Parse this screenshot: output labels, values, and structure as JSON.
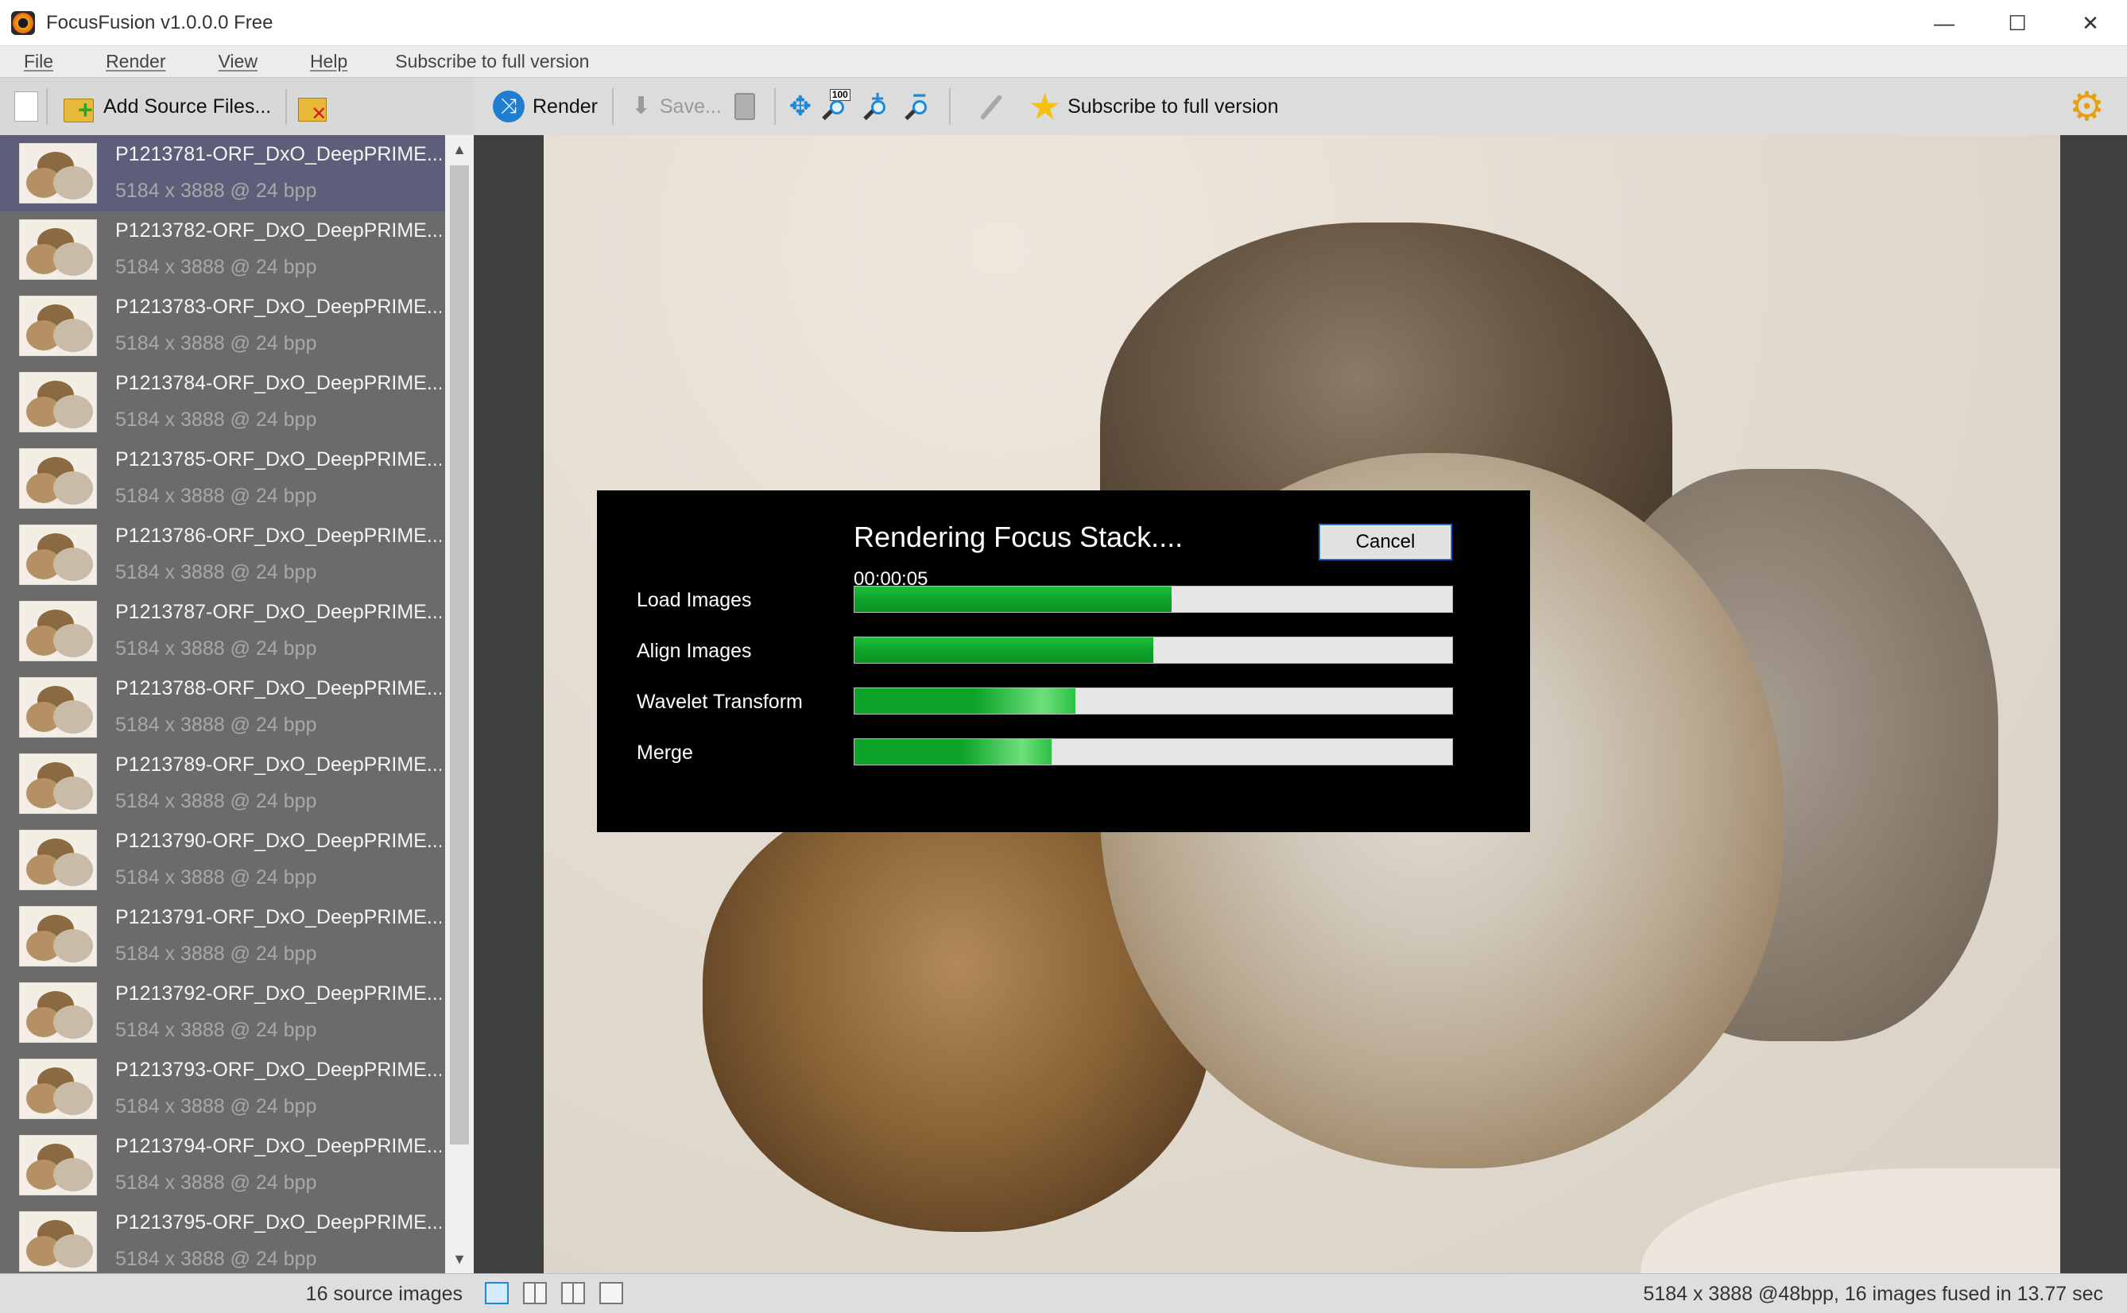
{
  "window": {
    "title": "FocusFusion v1.0.0.0 Free",
    "minimize": "—",
    "maximize": "☐",
    "close": "✕"
  },
  "menu": {
    "file": "File",
    "render": "Render",
    "view": "View",
    "help": "Help",
    "subscribe": "Subscribe to full version"
  },
  "toolbar": {
    "add_source": "Add Source Files...",
    "render": "Render",
    "save": "Save...",
    "subscribe": "Subscribe to full version",
    "zoom_100_tag": "100"
  },
  "icons": {
    "render": "shuffle-render-icon",
    "gear": "gear-icon",
    "star": "star-icon"
  },
  "files": [
    {
      "name": "P1213781-ORF_DxO_DeepPRIME....",
      "dims": "5184 x 3888 @ 24 bpp"
    },
    {
      "name": "P1213782-ORF_DxO_DeepPRIME....",
      "dims": "5184 x 3888 @ 24 bpp"
    },
    {
      "name": "P1213783-ORF_DxO_DeepPRIME....",
      "dims": "5184 x 3888 @ 24 bpp"
    },
    {
      "name": "P1213784-ORF_DxO_DeepPRIME....",
      "dims": "5184 x 3888 @ 24 bpp"
    },
    {
      "name": "P1213785-ORF_DxO_DeepPRIME....",
      "dims": "5184 x 3888 @ 24 bpp"
    },
    {
      "name": "P1213786-ORF_DxO_DeepPRIME....",
      "dims": "5184 x 3888 @ 24 bpp"
    },
    {
      "name": "P1213787-ORF_DxO_DeepPRIME....",
      "dims": "5184 x 3888 @ 24 bpp"
    },
    {
      "name": "P1213788-ORF_DxO_DeepPRIME....",
      "dims": "5184 x 3888 @ 24 bpp"
    },
    {
      "name": "P1213789-ORF_DxO_DeepPRIME....",
      "dims": "5184 x 3888 @ 24 bpp"
    },
    {
      "name": "P1213790-ORF_DxO_DeepPRIME....",
      "dims": "5184 x 3888 @ 24 bpp"
    },
    {
      "name": "P1213791-ORF_DxO_DeepPRIME....",
      "dims": "5184 x 3888 @ 24 bpp"
    },
    {
      "name": "P1213792-ORF_DxO_DeepPRIME....",
      "dims": "5184 x 3888 @ 24 bpp"
    },
    {
      "name": "P1213793-ORF_DxO_DeepPRIME....",
      "dims": "5184 x 3888 @ 24 bpp"
    },
    {
      "name": "P1213794-ORF_DxO_DeepPRIME....",
      "dims": "5184 x 3888 @ 24 bpp"
    },
    {
      "name": "P1213795-ORF_DxO_DeepPRIME....",
      "dims": "5184 x 3888 @ 24 bpp"
    }
  ],
  "dialog": {
    "title": "Rendering Focus Stack....",
    "elapsed": "00:00:05",
    "cancel": "Cancel",
    "stages": [
      {
        "label": "Load Images",
        "progress": 0.53
      },
      {
        "label": "Align Images",
        "progress": 0.5
      },
      {
        "label": "Wavelet Transform",
        "progress": 0.37
      },
      {
        "label": "Merge",
        "progress": 0.33
      }
    ]
  },
  "status": {
    "source_count": "16 source images",
    "result_info": "5184 x 3888 @48bpp, 16 images fused in 13.77 sec"
  },
  "colors": {
    "progress_green": "#0ea42a",
    "accent_blue": "#1e88d8",
    "selected_row": "#5e5e7a"
  }
}
